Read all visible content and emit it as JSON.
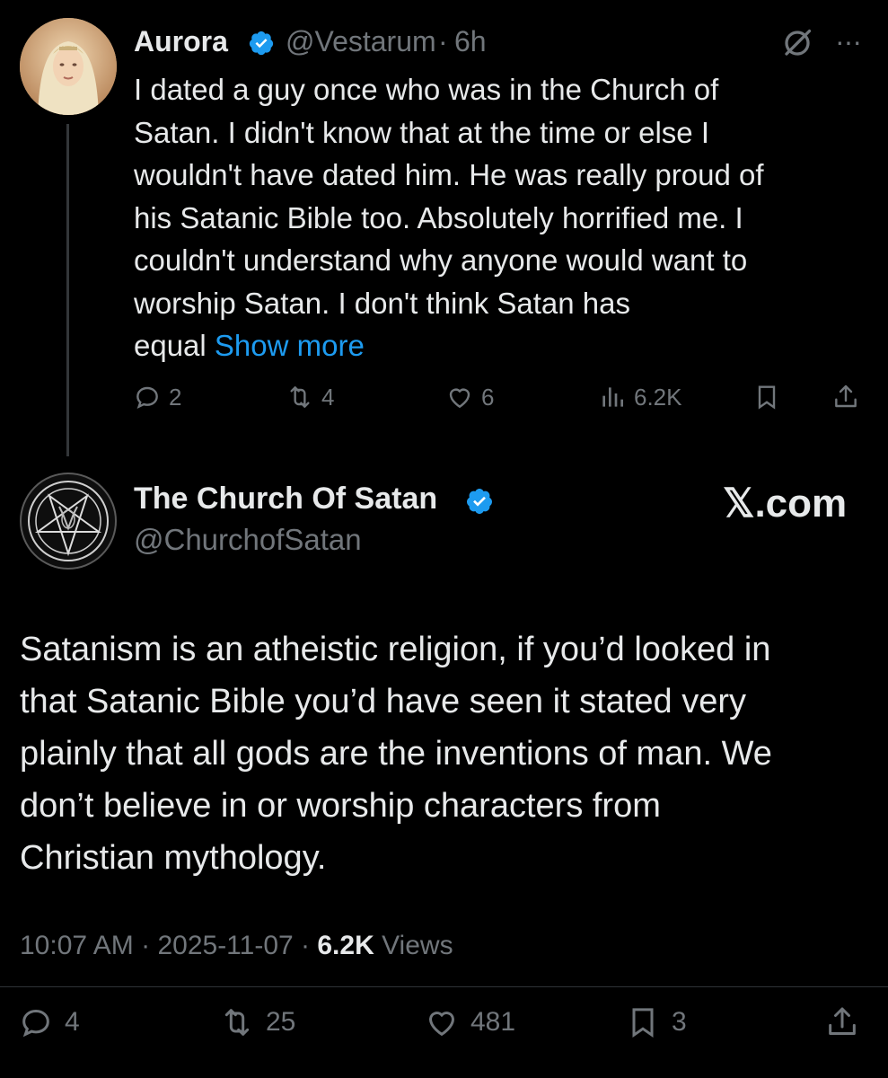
{
  "parent_tweet": {
    "name": "Aurora",
    "handle": "@Vestarum",
    "separator": "·",
    "time": "6h",
    "text_lines": [
      "I dated a guy once who was in the Church of",
      "Satan. I didn't know that at the time or else I",
      "wouldn't have dated him. He was really proud of",
      "his Satanic Bible too. Absolutely horrified me. I",
      "couldn't understand why anyone would want to",
      "worship Satan. I don't think Satan has",
      "equal"
    ],
    "show_more": "Show more",
    "stats": {
      "replies": "2",
      "reposts": "4",
      "likes": "6",
      "views": "6.2K"
    }
  },
  "reply_tweet": {
    "name": "The Church Of Satan",
    "handle": "@ChurchofSatan",
    "watermark": "𝕏.com",
    "text_lines": [
      "Satanism is an atheistic religion, if you’d looked in",
      "that Satanic Bible you’d have seen it stated very",
      "plainly that all gods are the inventions of man. We",
      "don’t believe in or worship characters from",
      "Christian mythology."
    ],
    "time": "10:07 AM",
    "date": "2025-11-07",
    "views_count": "6.2K",
    "views_label": "Views",
    "stats": {
      "replies": "4",
      "reposts": "25",
      "likes": "481",
      "bookmarks": "3"
    }
  },
  "colors": {
    "background": "#000000",
    "text": "#e7e9ea",
    "muted": "#71767b",
    "link": "#1d9bf0",
    "verified": "#1d9bf0"
  },
  "icons": [
    "verified-badge-icon",
    "grok-icon",
    "more-icon",
    "reply-icon",
    "repost-icon",
    "like-icon",
    "views-icon",
    "bookmark-icon",
    "share-icon",
    "pentagram-avatar-icon"
  ]
}
